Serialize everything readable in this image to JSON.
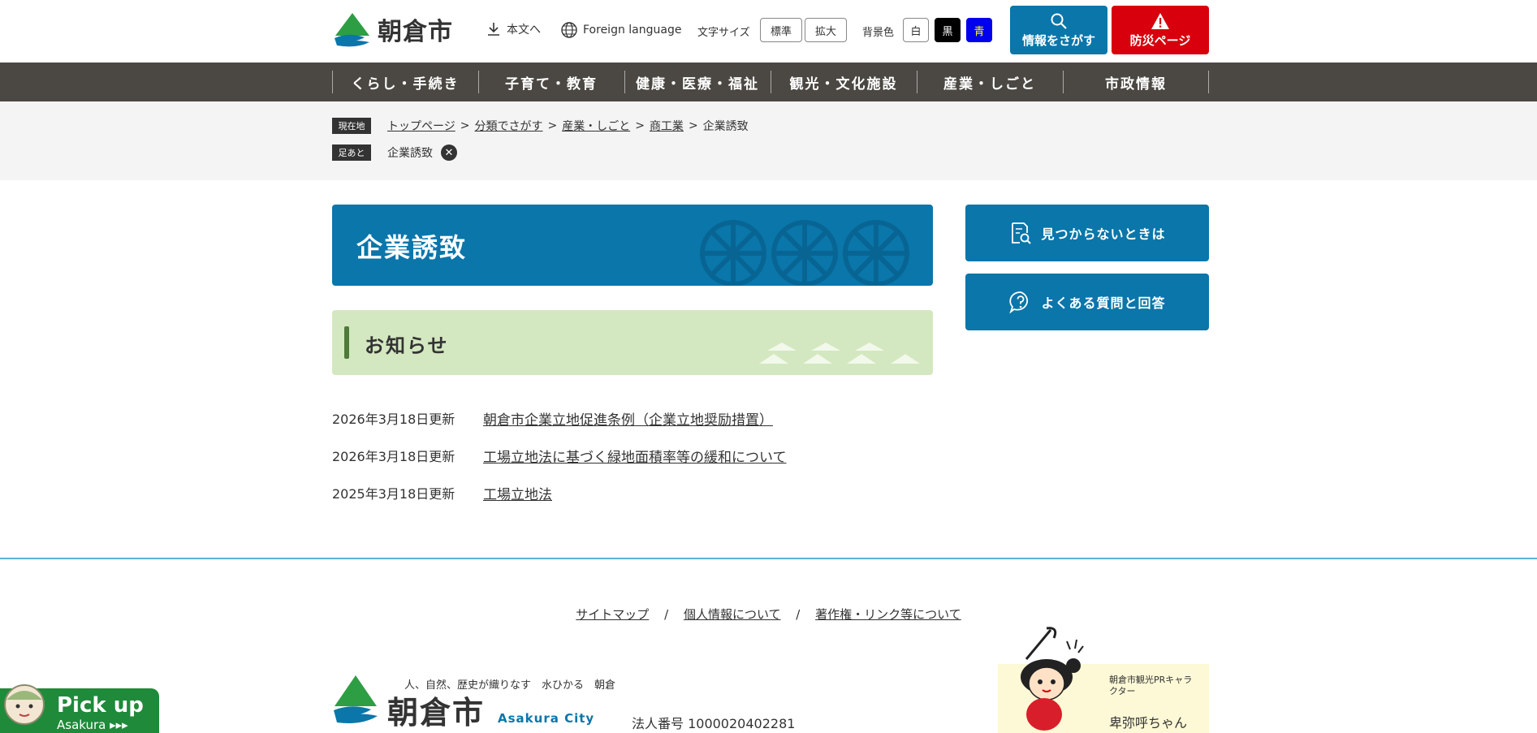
{
  "colors": {
    "primary": "#0a76aa",
    "danger": "#d8000c",
    "nav_bg": "#4b4843",
    "news_head_bg": "#d3e8c0",
    "pickup_green": "#1f8a3a"
  },
  "header": {
    "logo_text": "朝倉市",
    "skip_link": "本文へ",
    "foreign_language": "Foreign language",
    "font_size_label": "文字サイズ",
    "font_size_standard": "標準",
    "font_size_large": "拡大",
    "bg_color_label": "背景色",
    "bg_white": "白",
    "bg_black": "黒",
    "bg_blue": "青",
    "search_button": "情報をさがす",
    "disaster_button": "防災ページ"
  },
  "nav": {
    "items": [
      {
        "label": "くらし・手続き"
      },
      {
        "label": "子育て・教育"
      },
      {
        "label": "健康・医療・福祉"
      },
      {
        "label": "観光・文化施設"
      },
      {
        "label": "産業・しごと"
      },
      {
        "label": "市政情報"
      }
    ]
  },
  "breadcrumb": {
    "current_tag": "現在地",
    "items": [
      "トップページ",
      "分類でさがす",
      "産業・しごと",
      "商工業"
    ],
    "current": "企業誘致",
    "history_tag": "足あと",
    "history_item": "企業誘致"
  },
  "main": {
    "title": "企業誘致",
    "news_heading": "お知らせ",
    "news": [
      {
        "date": "2026年3月18日更新",
        "title": "朝倉市企業立地促進条例（企業立地奨励措置）"
      },
      {
        "date": "2026年3月18日更新",
        "title": "工場立地法に基づく緑地面積率等の緩和について"
      },
      {
        "date": "2025年3月18日更新",
        "title": "工場立地法"
      }
    ]
  },
  "side": {
    "not_found": "見つからないときは",
    "faq": "よくある質問と回答"
  },
  "footer": {
    "links": [
      "サイトマップ",
      "個人情報について",
      "著作権・リンク等について"
    ],
    "slash": "/",
    "catch": "人、自然、歴史が織りなす　水ひかる　朝倉",
    "logo_text": "朝倉市",
    "city_en": "Asakura City",
    "corp_number": "法人番号 1000020402281",
    "mascot_caption": "朝倉市観光PRキャラクター",
    "mascot_name": "卑弥呼ちゃん"
  },
  "pickup": {
    "title": "Pick up",
    "sub": "Asakura ▸▸▸"
  }
}
